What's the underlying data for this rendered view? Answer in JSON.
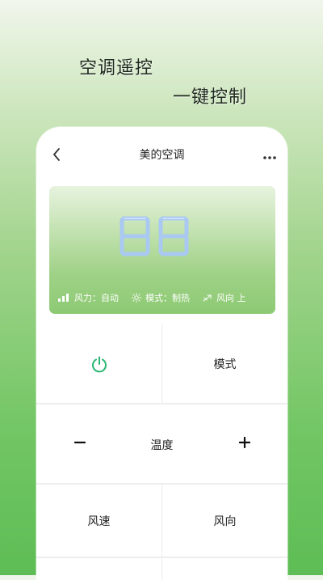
{
  "promo": {
    "line1": "空调遥控",
    "line2": "一键控制"
  },
  "nav": {
    "back_icon": "chevron-left-icon",
    "title": "美的空调",
    "more_icon": "more-horizontal-icon"
  },
  "display": {
    "digits": "88",
    "status": [
      {
        "icon": "signal-bars-icon",
        "label": "风力：自动"
      },
      {
        "icon": "sun-icon",
        "label": "模式：制热"
      },
      {
        "icon": "wind-direction-icon",
        "label": "风向 上"
      }
    ]
  },
  "controls": {
    "power_icon": "power-icon",
    "mode_label": "模式",
    "temp_label": "温度",
    "minus_label": "−",
    "plus_label": "+",
    "speed_label": "风速",
    "direction_label": "风向"
  },
  "colors": {
    "accent": "#2bb673",
    "display_digits": "#a9c8f2",
    "phone_bg": "#ffffff"
  }
}
